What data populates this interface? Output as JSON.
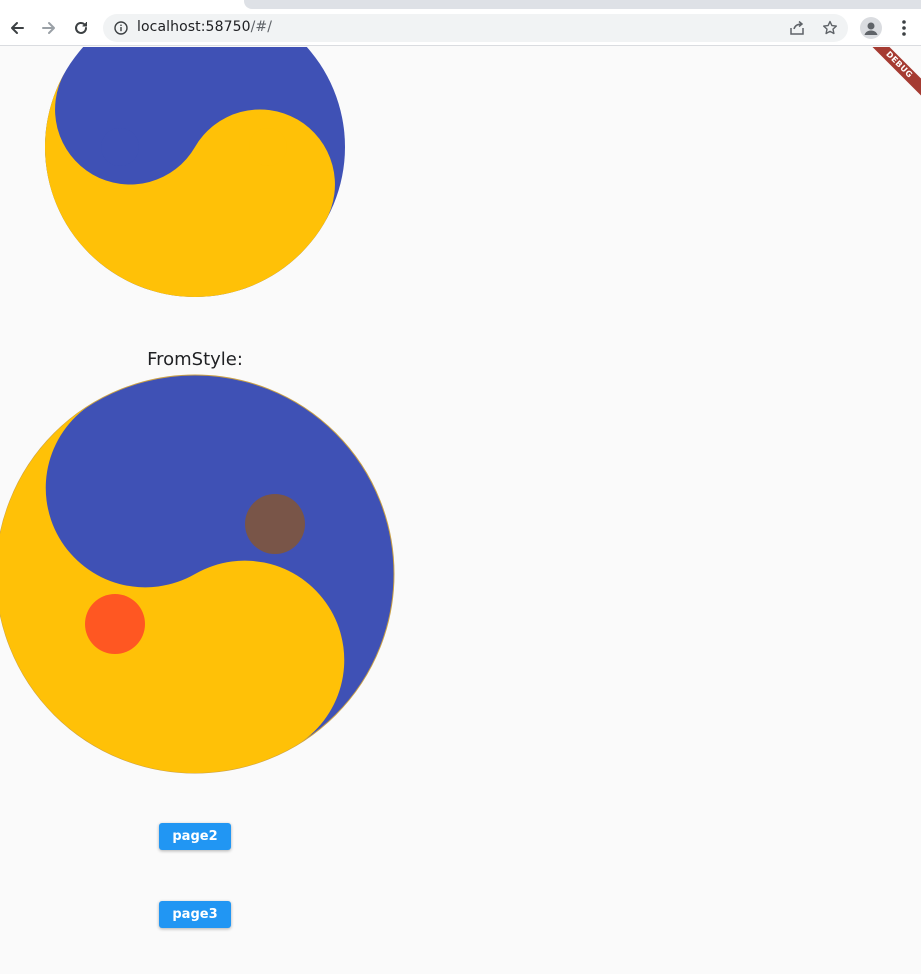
{
  "browser": {
    "url_host": "localhost:58750",
    "url_path": "/#/"
  },
  "debug_banner": {
    "label": "DEBUG"
  },
  "page": {
    "caption": "FromStyle:",
    "buttons": [
      {
        "label": "page2"
      },
      {
        "label": "page3"
      }
    ]
  },
  "taiji_top": {
    "yang_color": "#ffc107",
    "yin_color": "#3f51b5",
    "yang_dot_color": "#ffc107",
    "yin_dot_color": "#3f51b5"
  },
  "taiji_bottom": {
    "yang_color": "#ffc107",
    "yin_color": "#3f51b5",
    "yang_dot_color": "#795548",
    "yin_dot_color": "#ff5722"
  },
  "colors": {
    "accent_button": "#2196f3",
    "debug_ribbon": "#a53b32"
  }
}
